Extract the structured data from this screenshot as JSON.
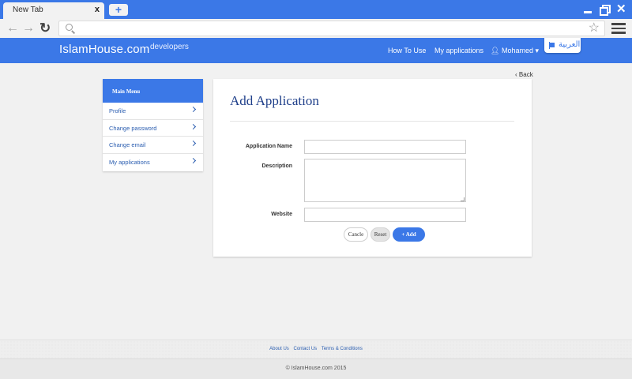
{
  "browser": {
    "tab_title": "New Tab",
    "tab_close": "x",
    "new_tab_label": "+",
    "url": ""
  },
  "header": {
    "logo": "IslamHouse.com",
    "logo_sub": "developers",
    "nav": {
      "how_to_use": "How To Use",
      "my_applications": "My applications",
      "user": "Mohamed ▾"
    },
    "language": "العربية"
  },
  "back_link": "Back",
  "sidebar": {
    "title": "Main Menu",
    "items": [
      {
        "label": "Profile"
      },
      {
        "label": "Change password"
      },
      {
        "label": "Change email"
      },
      {
        "label": "My applications"
      }
    ]
  },
  "form": {
    "title": "Add Application",
    "fields": {
      "name": {
        "label": "Application Name",
        "value": "",
        "placeholder": ""
      },
      "description": {
        "label": "Description",
        "value": "",
        "placeholder": ""
      },
      "website": {
        "label": "Website",
        "value": "",
        "placeholder": ""
      }
    },
    "buttons": {
      "cancel": "Cancle",
      "reset": "Reset",
      "add": "+ Add"
    }
  },
  "footer": {
    "links": [
      "About Us",
      "Contact Us",
      "Terms & Conditions"
    ],
    "copyright": "© IslamHouse.com 2015"
  },
  "colors": {
    "primary": "#3b78e7",
    "title": "#1f3f8a",
    "link": "#2a5db0"
  }
}
